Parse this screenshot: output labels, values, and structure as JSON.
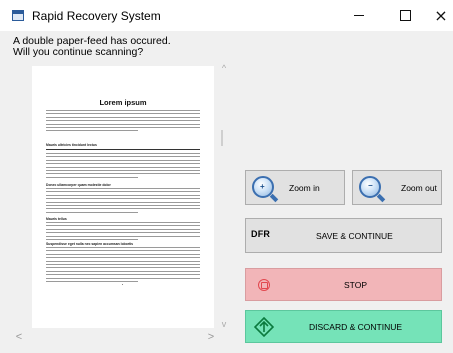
{
  "window": {
    "title": "Rapid Recovery System",
    "controls": {
      "minimize": "minimize",
      "maximize": "maximize",
      "close": "×"
    }
  },
  "message": {
    "line1": "A double paper-feed has occured.",
    "line2": "Will you continue scanning?"
  },
  "preview": {
    "document_title": "Lorem ipsum",
    "section_headings": [
      "Mauris ultricies tincidunt lectus",
      "Donec ullamcorper quam molestie dolor",
      "Mauris tellus",
      "Suspendisse eget nulla nec sapien accumsan lobortis"
    ],
    "scroll_up": "^",
    "scroll_down": "v",
    "scroll_left": "<",
    "scroll_right": ">"
  },
  "buttons": {
    "zoom_in": "Zoom in",
    "zoom_out": "Zoom out",
    "save_prefix": "DFR",
    "save_continue": "SAVE & CONTINUE",
    "stop": "STOP",
    "discard_continue": "DISCARD & CONTINUE"
  },
  "colors": {
    "stop_bg": "#f2b5b8",
    "discard_bg": "#75e3b8",
    "neutral_bg": "#e1e1e1"
  }
}
